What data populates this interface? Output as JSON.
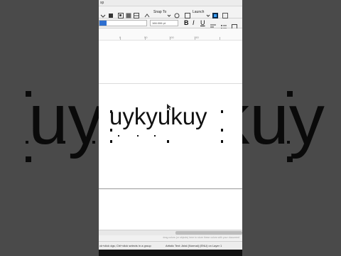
{
  "app": {
    "title_fragment": "sp"
  },
  "toolbar": {
    "snap_label": "Snap To",
    "launch_label": "Launch"
  },
  "property_bar": {
    "font_size_value": "166.006 pt",
    "bold_label": "B",
    "italic_label": "I",
    "underline_label": "U"
  },
  "ruler": {
    "marks": [
      "0",
      "50",
      "100",
      "150"
    ]
  },
  "canvas": {
    "artistic_text": "uykyukuy",
    "background_text": "uykyukuy"
  },
  "hint_bar": {
    "text": "drag colors (or objects) here to store these colors with your document"
  },
  "status": {
    "left": "ck+click dgs; Ctrl+click selects in a group",
    "right": "Artistic Text: Arial (Normal) (ENU) on Layer 1"
  },
  "colors": {
    "selection_accent": "#2e6fd0",
    "window_bg": "#ffffff",
    "backdrop": "#4a4a4a"
  }
}
